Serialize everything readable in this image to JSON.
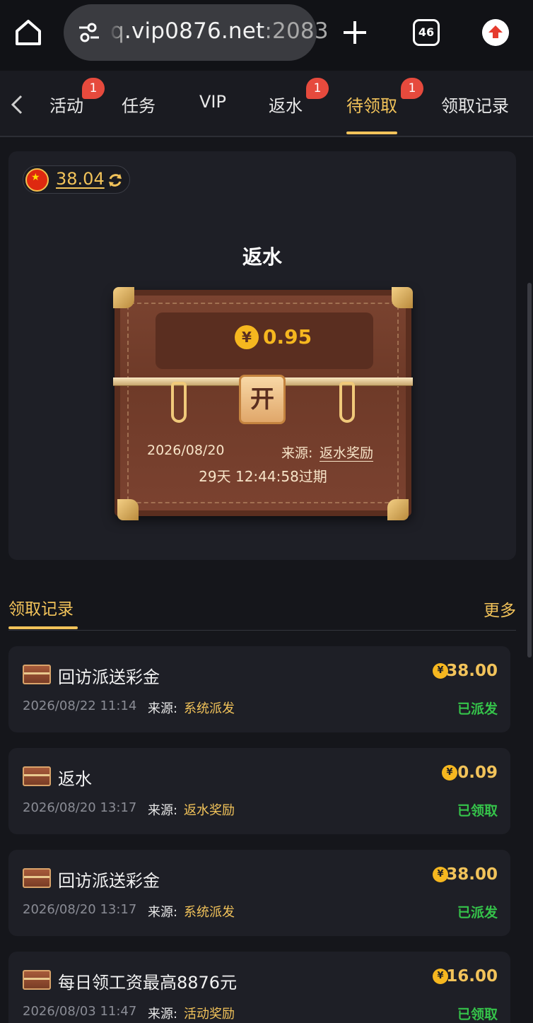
{
  "browser": {
    "url_partial_prefix": "q",
    "url_host": ".vip0876.net",
    "url_port": ":2083",
    "tab_count": "46",
    "icons": [
      "home-icon",
      "site-settings-icon",
      "plus-icon",
      "tabs-icon",
      "update-icon"
    ]
  },
  "nav": {
    "tabs": [
      {
        "label": "活动",
        "badge": "1"
      },
      {
        "label": "任务"
      },
      {
        "label": "VIP"
      },
      {
        "label": "返水",
        "badge": "1"
      },
      {
        "label": "待领取",
        "badge": "1",
        "active": true
      },
      {
        "label": "领取记录"
      }
    ]
  },
  "balance": {
    "value": "38.04",
    "currency_flag": "china-flag-icon"
  },
  "card": {
    "title": "返水"
  },
  "chest": {
    "amount": "0.95",
    "coin_symbol": "¥",
    "lock_label": "开",
    "date": "2026/08/20",
    "source_label": "来源:",
    "source": "返水奖励",
    "expire": "29天 12:44:58过期"
  },
  "records": {
    "title": "领取记录",
    "more": "更多",
    "items": [
      {
        "name": "回访派送彩金",
        "amount": "38.00",
        "time": "2026/08/22 11:14",
        "source_label": "来源:",
        "source": "系统派发",
        "status": "已派发"
      },
      {
        "name": "返水",
        "amount": "0.09",
        "time": "2026/08/20 13:17",
        "source_label": "来源:",
        "source": "返水奖励",
        "status": "已领取"
      },
      {
        "name": "回访派送彩金",
        "amount": "38.00",
        "time": "2026/08/20 13:17",
        "source_label": "来源:",
        "source": "系统派发",
        "status": "已派发"
      },
      {
        "name": "每日领工资最高8876元",
        "amount": "16.00",
        "time": "2026/08/03 11:47",
        "source_label": "来源:",
        "source": "活动奖励",
        "status": "已领取"
      }
    ]
  },
  "colors": {
    "accent": "#f2c35a",
    "badge": "#e64a3d",
    "success": "#35c34a",
    "background": "#15161b",
    "card": "#1e1f26"
  }
}
